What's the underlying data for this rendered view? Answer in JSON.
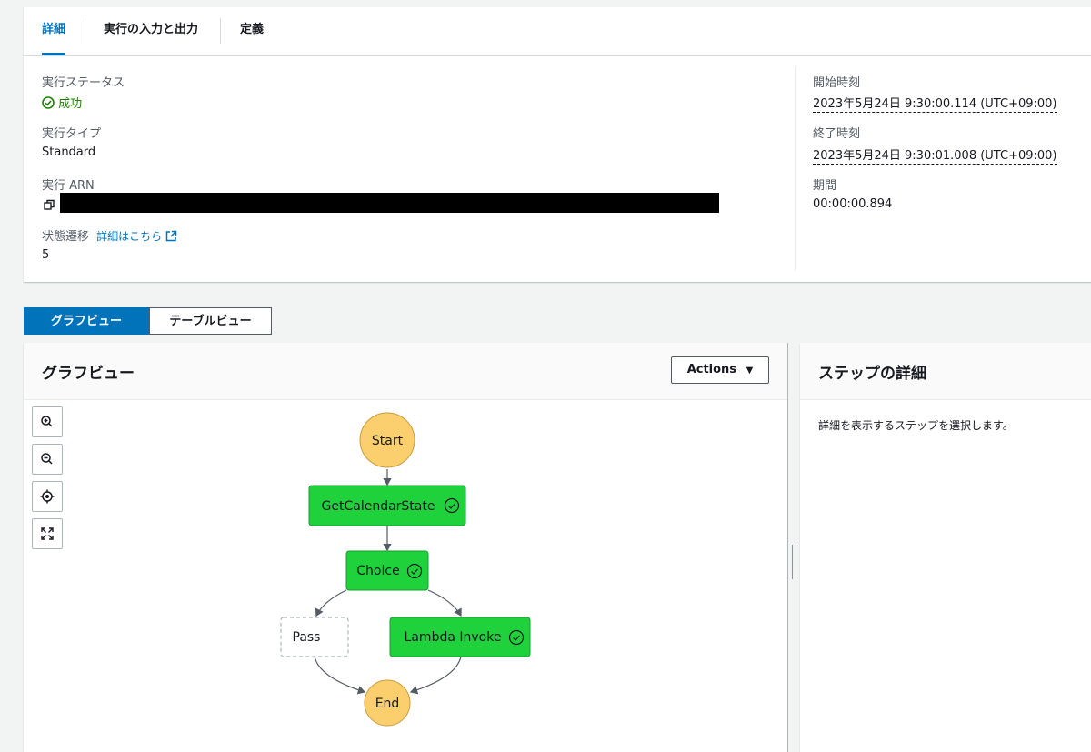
{
  "tabs": [
    "詳細",
    "実行の入力と出力",
    "定義"
  ],
  "summary": {
    "status_label": "実行ステータス",
    "status_value": "成功",
    "type_label": "実行タイプ",
    "type_value": "Standard",
    "arn_label": "実行 ARN",
    "transitions_label": "状態遷移",
    "transitions_link": "詳細はこちら",
    "transitions_value": "5",
    "start_label": "開始時刻",
    "start_value": "2023年5月24日 9:30:00.114 (UTC+09:00)",
    "end_label": "終了時刻",
    "end_value": "2023年5月24日 9:30:01.008 (UTC+09:00)",
    "duration_label": "期間",
    "duration_value": "00:00:00.894"
  },
  "view_toggle": {
    "graph": "グラフビュー",
    "table": "テーブルビュー"
  },
  "graph_panel": {
    "title": "グラフビュー",
    "actions": "Actions",
    "nodes": {
      "start": "Start",
      "get_calendar": "GetCalendarState",
      "choice": "Choice",
      "pass": "Pass",
      "lambda": "Lambda Invoke",
      "end": "End"
    },
    "icons": [
      "zoom-in-icon",
      "zoom-out-icon",
      "center-icon",
      "fit-icon"
    ]
  },
  "detail_panel": {
    "title": "ステップの詳細",
    "placeholder": "詳細を表示するステップを選択します。"
  },
  "colors": {
    "accent": "#0073bb",
    "success_node": "#1fd23b",
    "terminal_node": "#fccf6e",
    "success_text": "#1d8102"
  }
}
